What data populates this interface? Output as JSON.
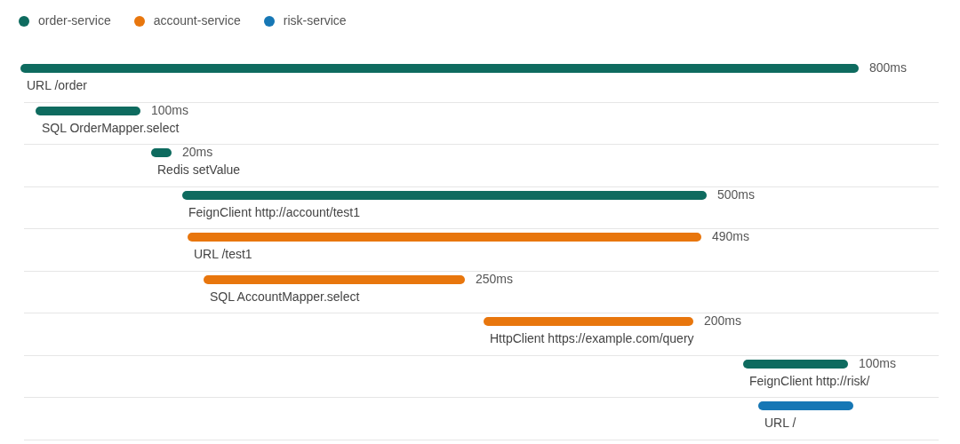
{
  "legend": [
    {
      "label": "order-service",
      "color": "#0e6b5f"
    },
    {
      "label": "account-service",
      "color": "#e8760d"
    },
    {
      "label": "risk-service",
      "color": "#1677b5"
    }
  ],
  "spans": [
    {
      "label": "URL /order",
      "duration": "800ms",
      "color": "#0e6b5f"
    },
    {
      "label": "SQL OrderMapper.select",
      "duration": "100ms",
      "color": "#0e6b5f"
    },
    {
      "label": "Redis setValue",
      "duration": "20ms",
      "color": "#0e6b5f"
    },
    {
      "label": "FeignClient http://account/test1",
      "duration": "500ms",
      "color": "#0e6b5f"
    },
    {
      "label": "URL /test1",
      "duration": "490ms",
      "color": "#e8760d"
    },
    {
      "label": "SQL AccountMapper.select",
      "duration": "250ms",
      "color": "#e8760d"
    },
    {
      "label": "HttpClient https://example.com/query",
      "duration": "200ms",
      "color": "#e8760d"
    },
    {
      "label": "FeignClient http://risk/",
      "duration": "100ms",
      "color": "#0e6b5f"
    },
    {
      "label": "URL /",
      "color": "#1677b5"
    }
  ]
}
